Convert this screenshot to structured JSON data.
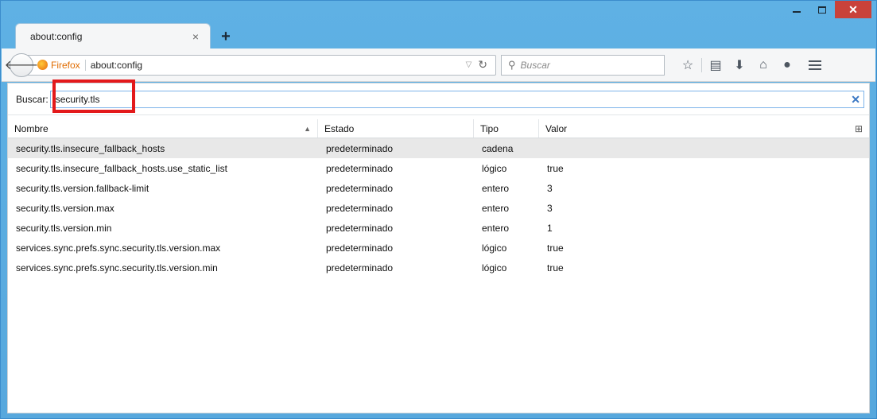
{
  "window": {
    "minimize_icon": "minimize-icon",
    "maximize_icon": "maximize-icon",
    "close_icon": "close-icon"
  },
  "tabs": [
    {
      "title": "about:config",
      "close_glyph": "×"
    }
  ],
  "newtab_glyph": "+",
  "navbar": {
    "identity_label": "Firefox",
    "url": "about:config",
    "search_placeholder": "Buscar",
    "icons": [
      "star-icon",
      "reading-list-icon",
      "download-icon",
      "home-icon",
      "chat-icon",
      "menu-icon"
    ]
  },
  "config": {
    "filter_label": "Buscar:",
    "filter_value": "security.tls",
    "columns": {
      "name": "Nombre",
      "state": "Estado",
      "type": "Tipo",
      "value": "Valor"
    },
    "rows": [
      {
        "name": "security.tls.insecure_fallback_hosts",
        "state": "predeterminado",
        "type": "cadena",
        "value": ""
      },
      {
        "name": "security.tls.insecure_fallback_hosts.use_static_list",
        "state": "predeterminado",
        "type": "lógico",
        "value": "true"
      },
      {
        "name": "security.tls.version.fallback-limit",
        "state": "predeterminado",
        "type": "entero",
        "value": "3"
      },
      {
        "name": "security.tls.version.max",
        "state": "predeterminado",
        "type": "entero",
        "value": "3"
      },
      {
        "name": "security.tls.version.min",
        "state": "predeterminado",
        "type": "entero",
        "value": "1"
      },
      {
        "name": "services.sync.prefs.sync.security.tls.version.max",
        "state": "predeterminado",
        "type": "lógico",
        "value": "true"
      },
      {
        "name": "services.sync.prefs.sync.security.tls.version.min",
        "state": "predeterminado",
        "type": "lógico",
        "value": "true"
      }
    ]
  },
  "colors": {
    "titlebar": "#5fb1e4",
    "close_button": "#c9423a",
    "highlight": "#e3191b",
    "filter_border": "#7eb4ea",
    "selected_row": "#e8e8e8"
  }
}
